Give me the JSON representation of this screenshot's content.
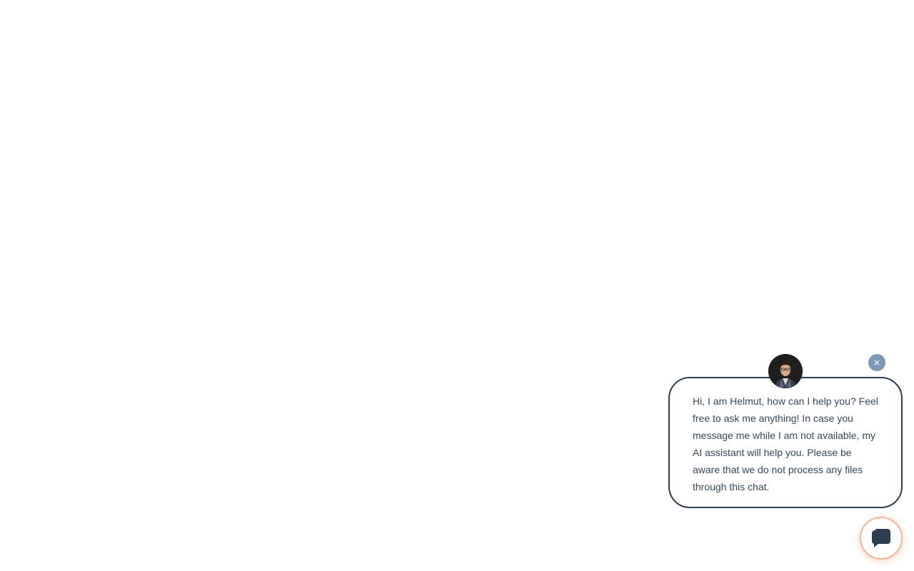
{
  "chat": {
    "welcome_message": "Hi, I am Helmut, how can I help you? Feel free to ask me anything! In case you message me while I am not available, my AI assistant will help you. Please be aware that we do not process any files through this chat.",
    "agent_avatar_icon": "person-avatar",
    "close_icon": "close-icon",
    "launcher_icon": "chat-bubble-icon",
    "colors": {
      "bubble_border": "#2d3e50",
      "text": "#33475b",
      "close_button": "#7c98b6",
      "launcher_ring": "#f0b89c",
      "launcher_icon": "#2d3e50"
    }
  }
}
